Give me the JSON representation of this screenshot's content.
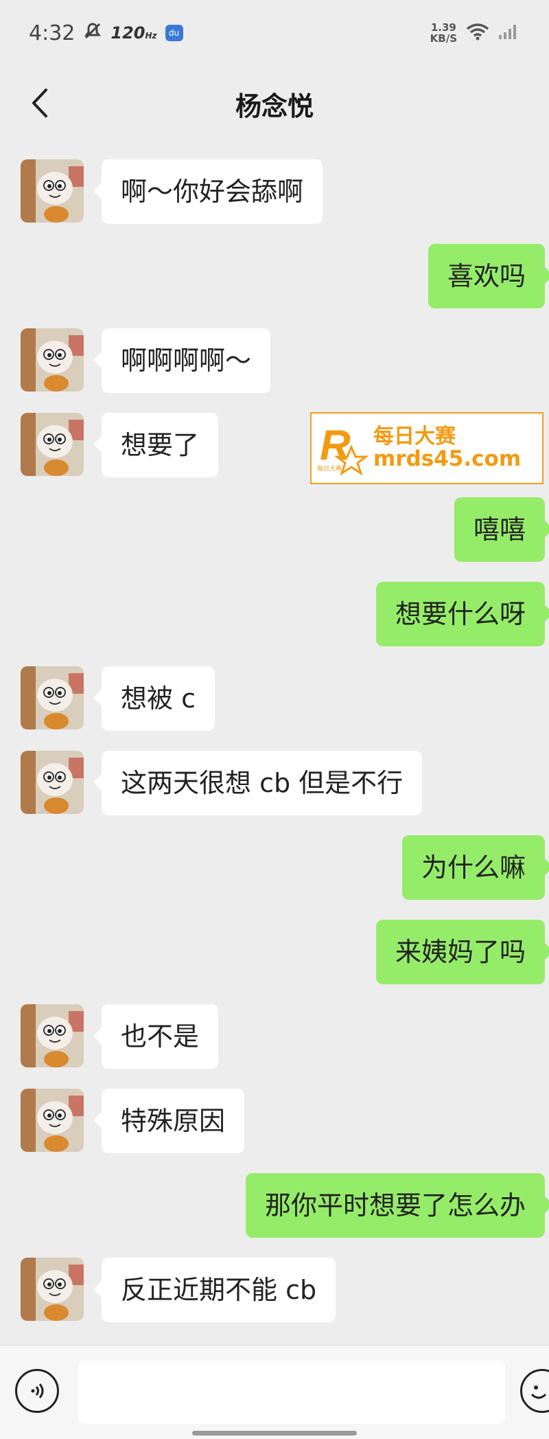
{
  "status_bar": {
    "time": "4:32",
    "refresh_rate": "120",
    "refresh_unit": "Hz",
    "badge": "du",
    "net_speed_value": "1.39",
    "net_speed_unit": "KB/S"
  },
  "header": {
    "title": "杨念悦"
  },
  "messages": [
    {
      "side": "in",
      "text": "啊～你好会舔啊"
    },
    {
      "side": "out",
      "text": "喜欢吗"
    },
    {
      "side": "in",
      "text": "啊啊啊啊～"
    },
    {
      "side": "in",
      "text": "想要了"
    },
    {
      "side": "out",
      "text": "嘻嘻"
    },
    {
      "side": "out",
      "text": "想要什么呀"
    },
    {
      "side": "in",
      "text": "想被 c"
    },
    {
      "side": "in",
      "text": "这两天很想 cb 但是不行"
    },
    {
      "side": "out",
      "text": "为什么嘛"
    },
    {
      "side": "out",
      "text": "来姨妈了吗"
    },
    {
      "side": "in",
      "text": "也不是"
    },
    {
      "side": "in",
      "text": "特殊原因"
    },
    {
      "side": "out",
      "text": "那你平时想要了怎么办"
    },
    {
      "side": "in",
      "text": "反正近期不能 cb"
    }
  ],
  "watermark": {
    "name": "每日大赛",
    "url": "mrds45.com",
    "logo_letter": "R",
    "logo_small": "每日大赛"
  },
  "input": {
    "value": "",
    "placeholder": ""
  },
  "colors": {
    "background": "#ededed",
    "incoming_bubble": "#ffffff",
    "outgoing_bubble": "#95ec69",
    "watermark": "#f39a12"
  },
  "icons": {
    "back": "chevron-left-icon",
    "voice": "voice-icon",
    "emoji": "emoji-icon",
    "wifi": "wifi-icon",
    "signal": "signal-icon",
    "mute": "mute-icon"
  }
}
